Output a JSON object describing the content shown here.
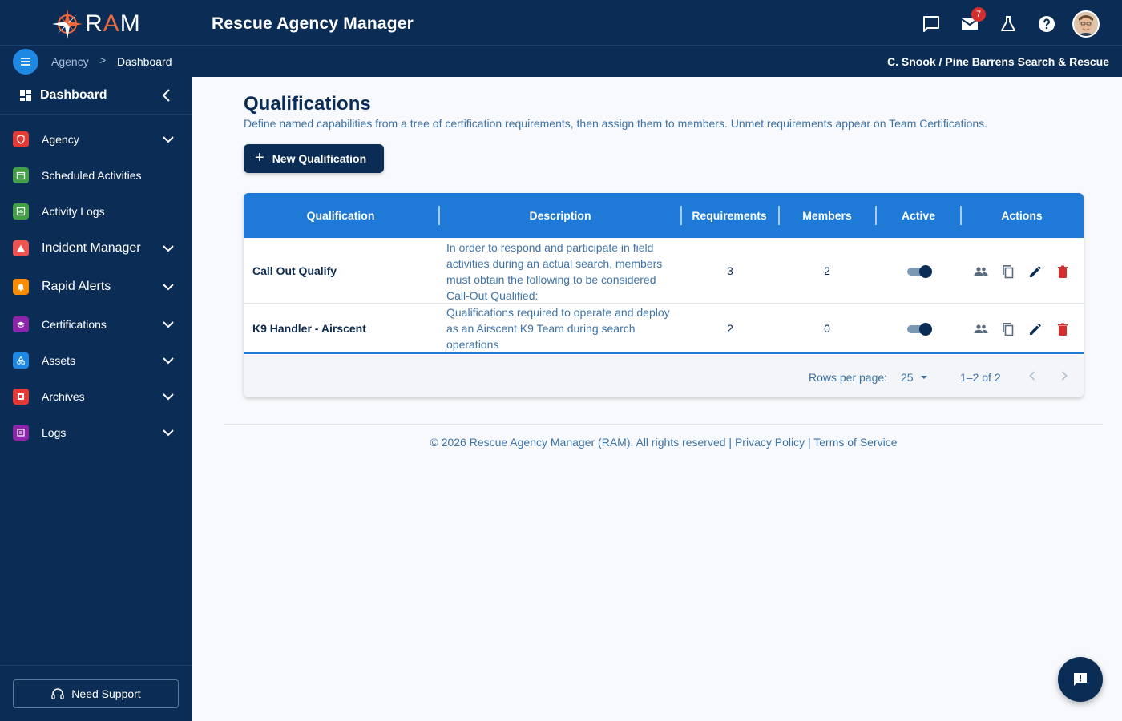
{
  "header": {
    "logo_text_left": "R",
    "logo_text_accent": "A",
    "logo_text_right": "M",
    "app_title": "Rescue Agency Manager",
    "mail_badge": "7",
    "icons": [
      "chat-icon",
      "mail-icon",
      "flask-icon",
      "help-icon"
    ]
  },
  "breadcrumb": {
    "items": [
      "Agency",
      "Dashboard"
    ],
    "separator": ">",
    "user": "C. Snook / Pine Barrens Search & Rescue"
  },
  "sidebar": {
    "title": "Dashboard",
    "items": [
      {
        "label": "Agency",
        "color": "#e53935",
        "expandable": true
      },
      {
        "label": "Scheduled Activities",
        "color": "#43a047",
        "expandable": false
      },
      {
        "label": "Activity Logs",
        "color": "#43a047",
        "expandable": false
      },
      {
        "label": "Incident Manager",
        "color": "#ef5350",
        "expandable": true
      },
      {
        "label": "Rapid Alerts",
        "color": "#fb8c00",
        "expandable": true
      },
      {
        "label": "Certifications",
        "color": "#8e24aa",
        "expandable": true
      },
      {
        "label": "Assets",
        "color": "#1e88e5",
        "expandable": true
      },
      {
        "label": "Archives",
        "color": "#e53935",
        "expandable": true
      },
      {
        "label": "Logs",
        "color": "#8e24aa",
        "expandable": true
      }
    ],
    "support_label": "Need Support"
  },
  "main": {
    "title": "Qualifications",
    "subtitle": "Define named capabilities from a tree of certification requirements, then assign them to members. Unmet requirements appear on Team Certifications.",
    "new_button": "New Qualification",
    "table": {
      "columns": [
        "Qualification",
        "Description",
        "Requirements",
        "Members",
        "Active",
        "Actions"
      ],
      "rows": [
        {
          "name": "Call Out Qualify",
          "description": "In order to respond and participate in field activities during an actual search, members must obtain the following to be considered Call-Out Qualified:",
          "requirements": "3",
          "members": "2",
          "active": true
        },
        {
          "name": "K9 Handler - Airscent",
          "description": "Qualifications required to operate and deploy as an Airscent K9 Team during search operations",
          "requirements": "2",
          "members": "0",
          "active": true
        }
      ],
      "rows_per_page_label": "Rows per page:",
      "rows_per_page": "25",
      "range": "1–2 of 2"
    }
  },
  "footer": {
    "copyright": "© 2026 Rescue Agency Manager (RAM). All rights reserved",
    "sep": "|",
    "privacy": "Privacy Policy",
    "terms": "Terms of Service"
  },
  "colors": {
    "nav_bg": "#0b2d55",
    "table_header": "#1e7ad6",
    "accent_blue": "#1e88e5",
    "delete_red": "#d32f2f"
  }
}
